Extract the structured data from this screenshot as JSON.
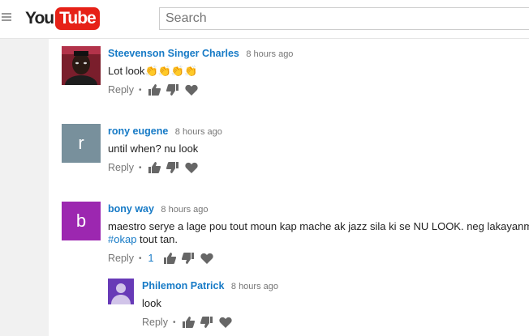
{
  "header": {
    "logo_you": "You",
    "logo_tube": "Tube",
    "search_placeholder": "Search"
  },
  "colors": {
    "link": "#167ac6",
    "logo_red": "#e62117",
    "icon_gray": "#666666"
  },
  "comments": [
    {
      "author": "Steevenson Singer Charles",
      "time": "8 hours ago",
      "text": "Lot look",
      "emoji": "👏👏👏👏",
      "reply_label": "Reply",
      "avatar_type": "photo"
    },
    {
      "author": "rony eugene",
      "time": "8 hours ago",
      "text": "until when? nu look",
      "reply_label": "Reply",
      "avatar_letter": "r",
      "avatar_color": "#78909c"
    },
    {
      "author": "bony way",
      "time": "8 hours ago",
      "text_line1": "maestro serye a lage pou tout moun kap mache ak jazz sila ki se NU LOOK. neg lakayanm",
      "hashtag": "#okap",
      "text_line2_rest": " tout tan.",
      "reply_label": "Reply",
      "likes": "1",
      "avatar_letter": "b",
      "avatar_color": "#9c27b0"
    },
    {
      "author": "Philemon Patrick",
      "time": "8 hours ago",
      "text": "look",
      "reply_label": "Reply",
      "avatar_type": "default",
      "avatar_color": "#673ab7"
    }
  ]
}
